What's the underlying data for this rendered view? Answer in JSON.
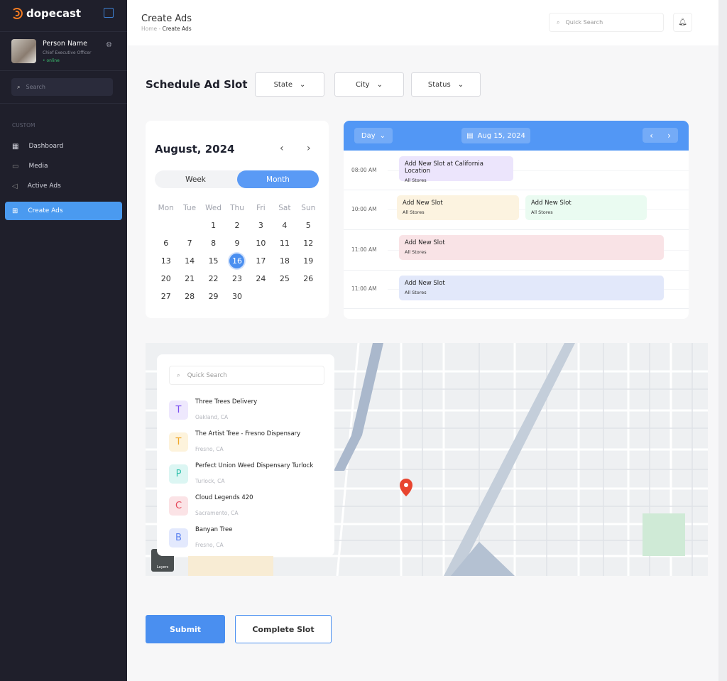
{
  "app": {
    "name": "dopecast"
  },
  "user": {
    "name": "Person Name",
    "role": "Chief Executive Officer",
    "status": "online"
  },
  "sidebar": {
    "search_placeholder": "Search",
    "section": "CUSTOM",
    "items": [
      {
        "label": "Dashboard",
        "icon": "grid-icon"
      },
      {
        "label": "Media",
        "icon": "folder-icon"
      },
      {
        "label": "Active Ads",
        "icon": "megaphone-icon"
      },
      {
        "label": "Create Ads",
        "icon": "plus-square-icon",
        "active": true
      }
    ]
  },
  "header": {
    "title": "Create Ads",
    "breadcrumb": [
      "Home",
      "Create Ads"
    ],
    "breadcrumb_sep": "-",
    "search_placeholder": "Quick Search"
  },
  "main": {
    "title": "Schedule Ad Slot",
    "filters": [
      "State",
      "City",
      "Status"
    ]
  },
  "calendar": {
    "month": "August, 2024",
    "toggle": [
      "Week",
      "Month"
    ],
    "active_toggle": "Month",
    "weekdays": [
      "Mon",
      "Tue",
      "Wed",
      "Thu",
      "Fri",
      "Sat",
      "Sun"
    ],
    "weeks": [
      [
        "",
        "",
        "1",
        "2",
        "3",
        "4",
        "5"
      ],
      [
        "6",
        "7",
        "8",
        "9",
        "10",
        "11",
        "12"
      ],
      [
        "13",
        "14",
        "15",
        "16",
        "17",
        "18",
        "19"
      ],
      [
        "20",
        "21",
        "22",
        "23",
        "24",
        "25",
        "26"
      ],
      [
        "27",
        "28",
        "29",
        "30",
        "",
        "",
        ""
      ]
    ],
    "selected": "16"
  },
  "schedule": {
    "view": "Day",
    "date": "Aug 15, 2024",
    "rows": [
      {
        "time": "08:00 AM",
        "slots": [
          {
            "title": "Add New Slot at California Location",
            "sub": "All Stores",
            "color": "#ece5fc"
          }
        ]
      },
      {
        "time": "10:00 AM",
        "slots": [
          {
            "title": "Add New Slot",
            "sub": "All Stores",
            "color": "#fcf3e0"
          },
          {
            "title": "Add New Slot",
            "sub": "All Stores",
            "color": "#eafbf1"
          }
        ]
      },
      {
        "time": "11:00 AM",
        "slots": [
          {
            "title": "Add New Slot",
            "sub": "All Stores",
            "color": "#f9e3e6"
          }
        ]
      },
      {
        "time": "11:00 AM",
        "slots": [
          {
            "title": "Add New Slot",
            "sub": "All Stores",
            "color": "#e2e8fa"
          }
        ]
      }
    ]
  },
  "map": {
    "search_placeholder": "Quick Search",
    "locations": [
      {
        "letter": "T",
        "name": "Three Trees Delivery",
        "city": "Oakland, CA",
        "bg": "#eee8fd",
        "fg": "#7a4ef0"
      },
      {
        "letter": "T",
        "name": "The Artist Tree - Fresno Dispensary",
        "city": "Fresno, CA",
        "bg": "#fdf3dc",
        "fg": "#f0a72a"
      },
      {
        "letter": "P",
        "name": "Perfect Union Weed Dispensary Turlock",
        "city": "Turlock, CA",
        "bg": "#dcf6f3",
        "fg": "#35c2ae"
      },
      {
        "letter": "C",
        "name": "Cloud Legends 420",
        "city": "Sacramento, CA",
        "bg": "#fbe3e6",
        "fg": "#e5485a"
      },
      {
        "letter": "B",
        "name": "Banyan Tree",
        "city": "Fresno, CA",
        "bg": "#e3e9fd",
        "fg": "#5b82f0"
      }
    ],
    "layers_label": "Layers"
  },
  "actions": {
    "submit": "Submit",
    "complete": "Complete Slot"
  },
  "colors": {
    "sidebar": "#1f1f2b",
    "accent": "#4a8ff0"
  }
}
